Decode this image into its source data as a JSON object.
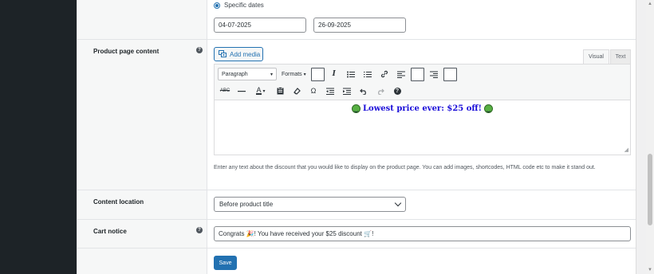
{
  "date_section": {
    "radio_label": "Specific dates",
    "start_date": "04-07-2025",
    "end_date": "26-09-2025"
  },
  "product_page_content": {
    "label": "Product page content",
    "help_glyph": "?",
    "add_media_label": "Add media",
    "tabs": {
      "visual": "Visual",
      "text": "Text"
    },
    "toolbar": {
      "paragraph_select": "Paragraph",
      "formats_label": "Formats"
    },
    "editor_text": "Lowest price ever: $25 off!",
    "description": "Enter any text about the discount that you would like to display on the product page. You can add images, shortcodes, HTML code etc to make it stand out."
  },
  "content_location": {
    "label": "Content location",
    "selected": "Before product title"
  },
  "cart_notice": {
    "label": "Cart notice",
    "help_glyph": "?",
    "value_prefix": "Congrats",
    "value_middle": "! You have received your $25 discount",
    "value_suffix": "!"
  },
  "actions": {
    "save_label": "Save"
  },
  "colors": {
    "accent": "#2271b1",
    "sidebar": "#1d2327",
    "editor_text": "#1a0dd8"
  }
}
